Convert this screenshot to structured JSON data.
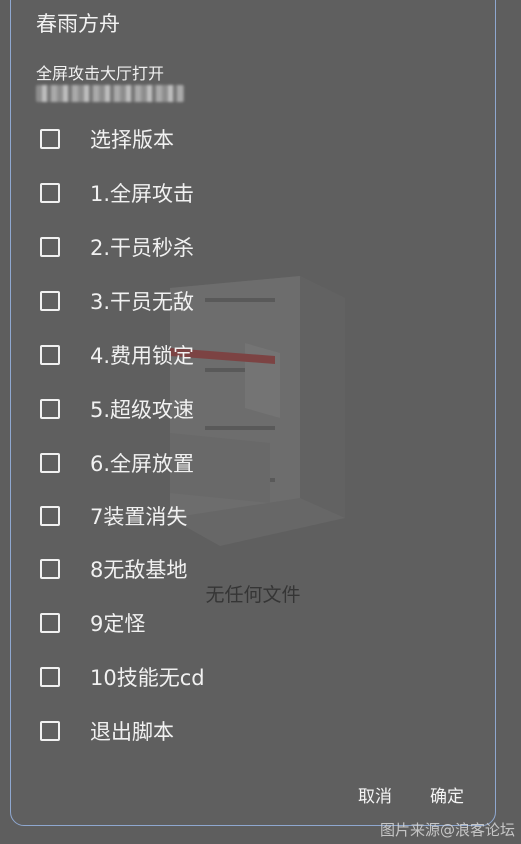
{
  "dialog": {
    "title": "春雨方舟",
    "subtitle": "全屏攻击大厅打开",
    "options": [
      {
        "label": "选择版本",
        "checked": false
      },
      {
        "label": "1.全屏攻击",
        "checked": false
      },
      {
        "label": "2.干员秒杀",
        "checked": false
      },
      {
        "label": "3.干员无敌",
        "checked": false
      },
      {
        "label": "4.费用锁定",
        "checked": false
      },
      {
        "label": "5.超级攻速",
        "checked": false
      },
      {
        "label": "6.全屏放置",
        "checked": false
      },
      {
        "label": "7装置消失",
        "checked": false
      },
      {
        "label": "8无敌基地",
        "checked": false
      },
      {
        "label": "9定怪",
        "checked": false
      },
      {
        "label": "10技能无cd",
        "checked": false
      },
      {
        "label": "退出脚本",
        "checked": false
      }
    ],
    "cancel_label": "取消",
    "ok_label": "确定"
  },
  "background": {
    "empty_text": "无任何文件"
  },
  "watermark": "图片来源@浪客论坛",
  "colors": {
    "backdrop": "#5e5e5e",
    "dialog_border": "#8fa8d0",
    "text": "#f1f1f1",
    "accent_red": "#b83a3a"
  }
}
